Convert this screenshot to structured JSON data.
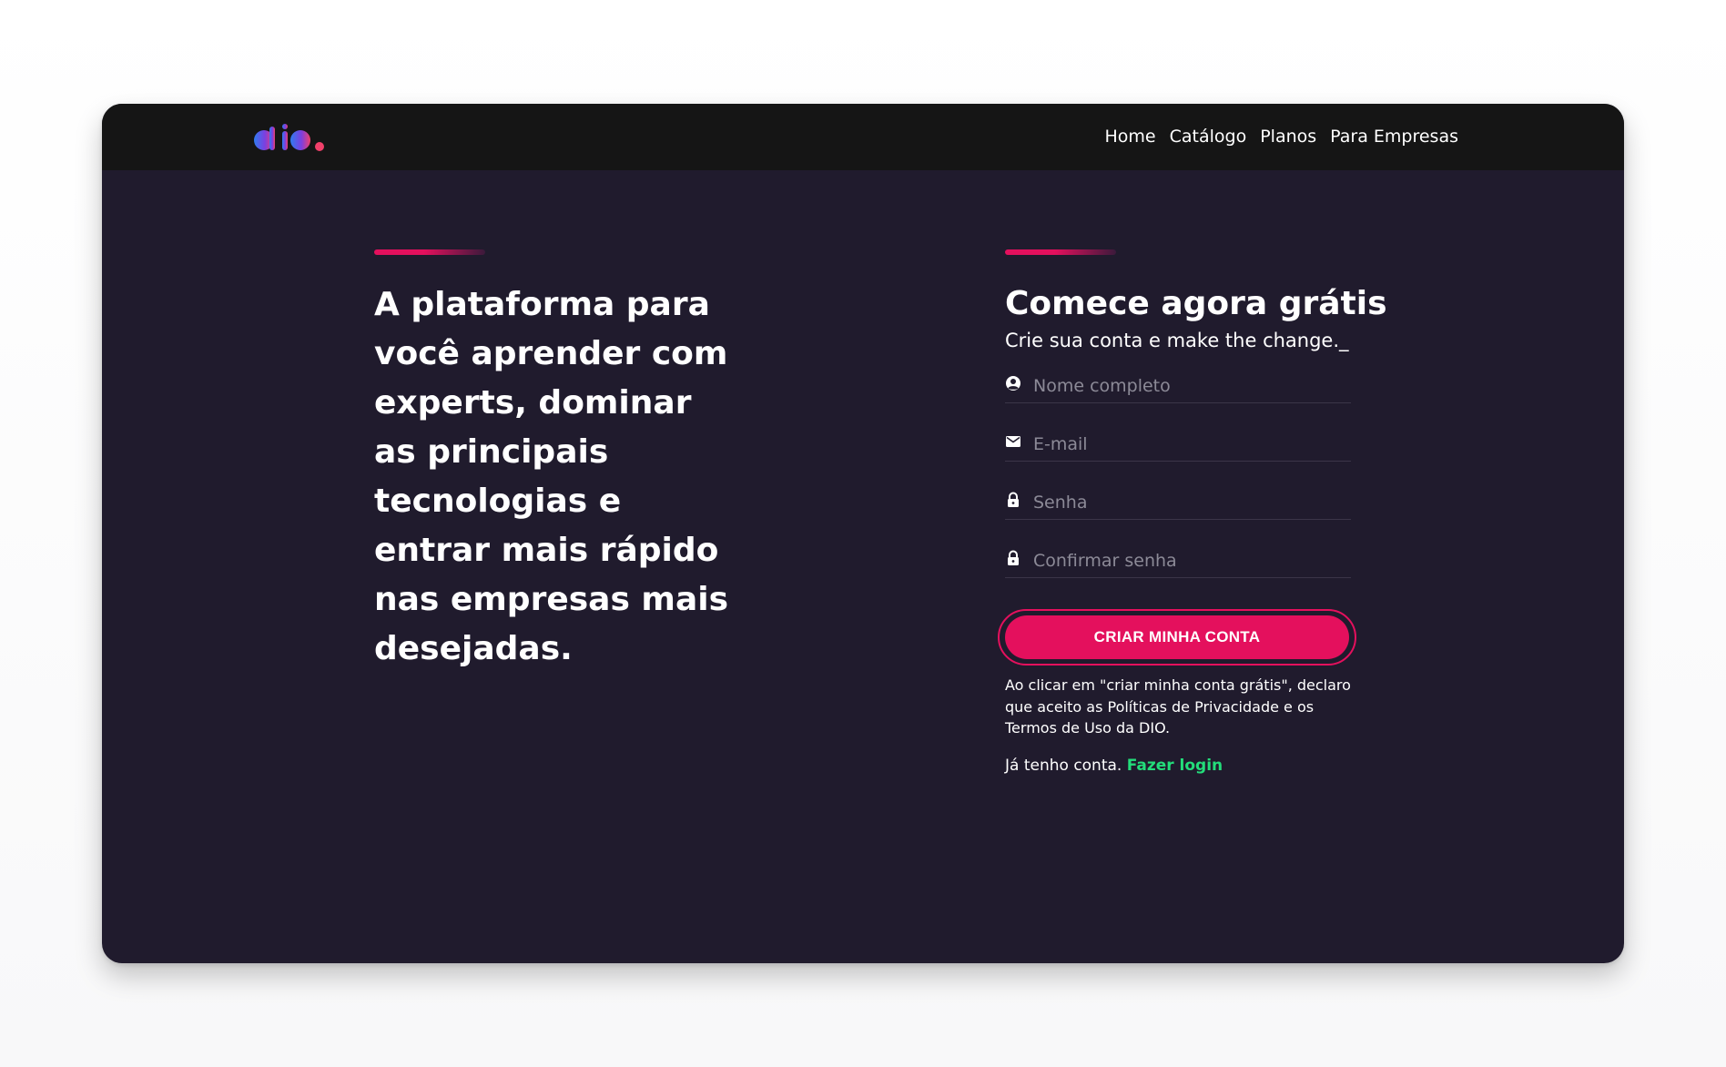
{
  "header": {
    "logo_alt": "dio",
    "nav": [
      {
        "label": "Home"
      },
      {
        "label": "Catálogo"
      },
      {
        "label": "Planos"
      },
      {
        "label": "Para Empresas"
      }
    ]
  },
  "hero": {
    "text": "A plataforma para você aprender com experts, dominar as principais tecnologias e entrar mais rápido nas empresas mais desejadas."
  },
  "signup": {
    "title": "Comece agora grátis",
    "subtitle": "Crie sua conta e make the change._",
    "fields": {
      "name": {
        "placeholder": "Nome completo",
        "value": "",
        "icon": "user-icon"
      },
      "email": {
        "placeholder": "E-mail",
        "value": "",
        "icon": "mail-icon"
      },
      "password": {
        "placeholder": "Senha",
        "value": "",
        "icon": "lock-icon"
      },
      "confirm": {
        "placeholder": "Confirmar senha",
        "value": "",
        "icon": "lock-icon"
      }
    },
    "button_label": "CRIAR MINHA CONTA",
    "disclaimer": "Ao clicar em \"criar minha conta grátis\", declaro que aceito as Políticas de Privacidade e os Termos de Uso da DIO.",
    "login_prompt": "Já tenho conta.",
    "login_link": "Fazer login"
  },
  "colors": {
    "navbar": "#151515",
    "background": "#201b2d",
    "accent": "#e4105d",
    "link": "#23dd7a"
  }
}
